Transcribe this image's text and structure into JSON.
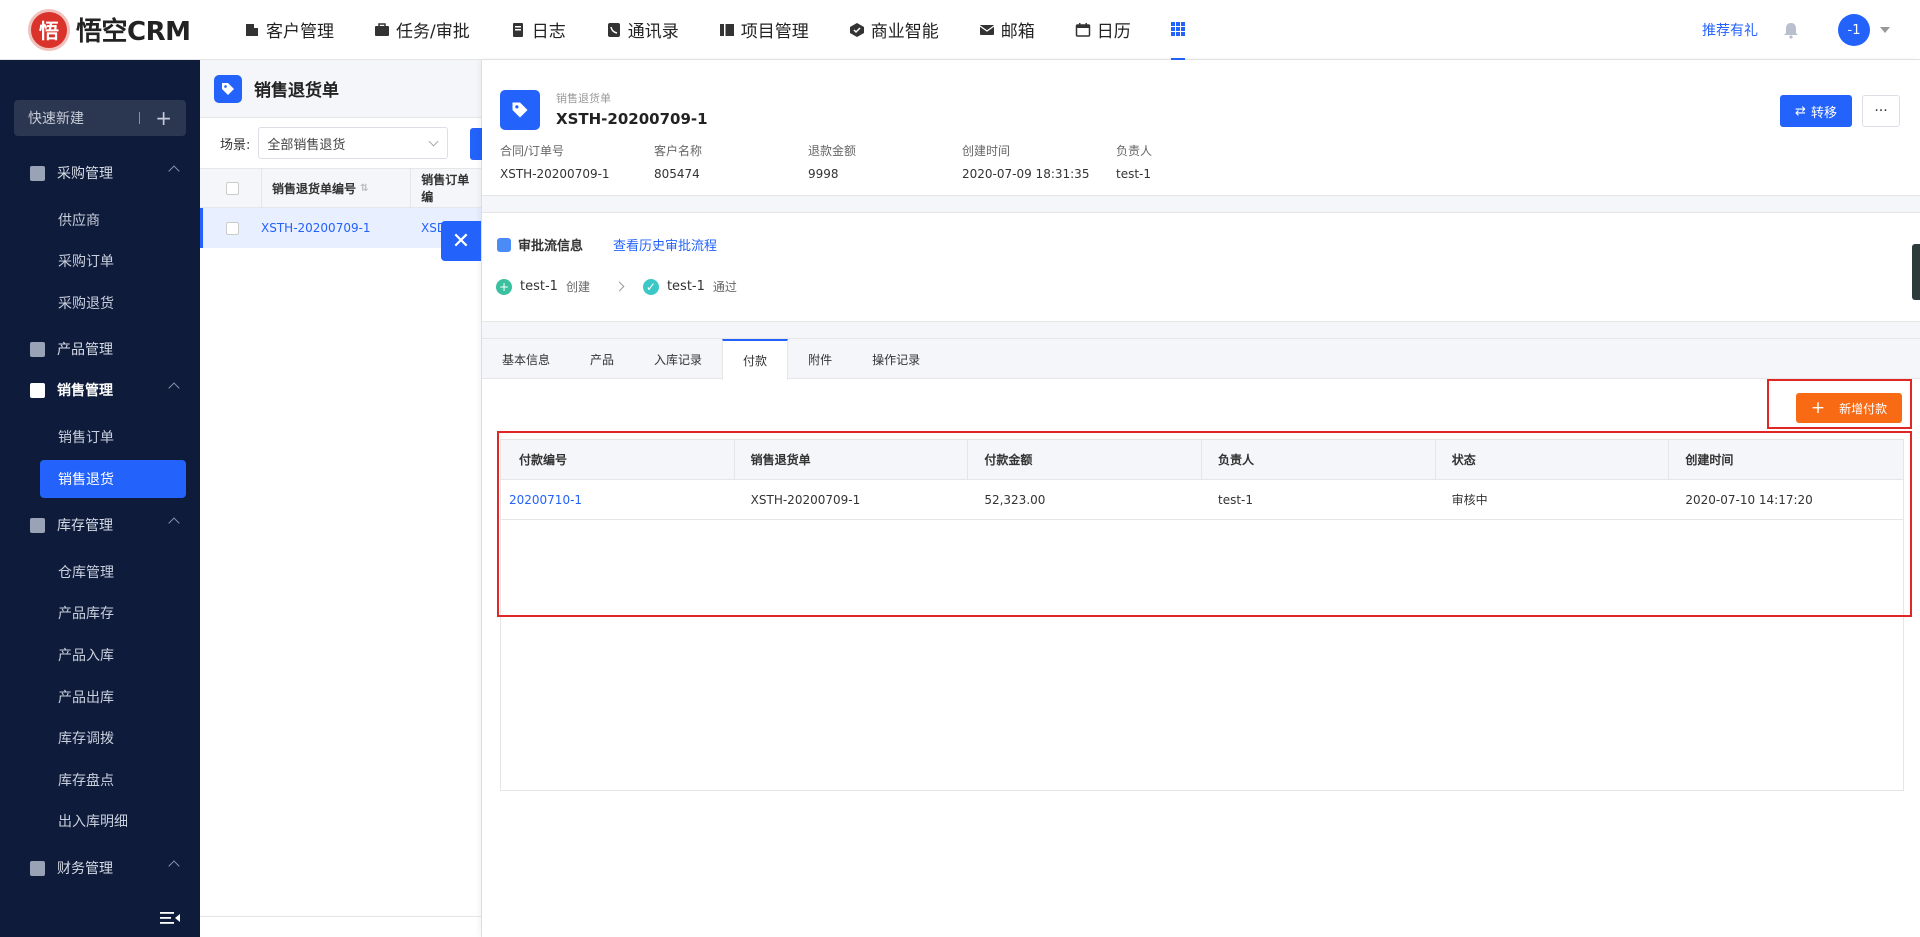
{
  "app": {
    "logo_mark": "悟",
    "logo_text": "悟空CRM"
  },
  "nav": {
    "items": [
      {
        "label": "客户管理",
        "icon": "building-icon"
      },
      {
        "label": "任务/审批",
        "icon": "briefcase-icon"
      },
      {
        "label": "日志",
        "icon": "log-icon"
      },
      {
        "label": "通讯录",
        "icon": "phone-icon"
      },
      {
        "label": "项目管理",
        "icon": "project-icon"
      },
      {
        "label": "商业智能",
        "icon": "bi-icon"
      },
      {
        "label": "邮箱",
        "icon": "mail-icon"
      },
      {
        "label": "日历",
        "icon": "calendar-icon"
      }
    ],
    "gift_label": "推荐有礼",
    "avatar_text": "-1"
  },
  "sidebar": {
    "quick_new": "快速新建",
    "groups": [
      {
        "label": "采购管理",
        "items": [
          "供应商",
          "采购订单",
          "采购退货"
        ]
      },
      {
        "label": "产品管理",
        "items": []
      },
      {
        "label": "销售管理",
        "items": [
          "销售订单",
          "销售退货"
        ]
      },
      {
        "label": "库存管理",
        "items": [
          "仓库管理",
          "产品库存",
          "产品入库",
          "产品出库",
          "库存调拨",
          "库存盘点",
          "出入库明细"
        ]
      },
      {
        "label": "财务管理",
        "items": []
      }
    ]
  },
  "list": {
    "title": "销售退货单",
    "scene_label": "场景:",
    "scene_value": "全部销售退货",
    "columns": [
      "销售退货单编号",
      "销售订单编"
    ],
    "rows": [
      {
        "no": "XSTH-20200709-1",
        "order": "XSD"
      }
    ]
  },
  "detail": {
    "subtitle": "销售退货单",
    "title": "XSTH-20200709-1",
    "transfer_label": "转移",
    "more_label": "···",
    "fields": [
      {
        "label": "合同/订单号",
        "value": "XSTH-20200709-1"
      },
      {
        "label": "客户名称",
        "value": "805474"
      },
      {
        "label": "退款金额",
        "value": "9998"
      },
      {
        "label": "创建时间",
        "value": "2020-07-09 18:31:35"
      },
      {
        "label": "负责人",
        "value": "test-1"
      }
    ],
    "approval": {
      "title": "审批流信息",
      "history_link": "查看历史审批流程",
      "steps": [
        {
          "user": "test-1",
          "action": "创建"
        },
        {
          "user": "test-1",
          "action": "通过"
        }
      ]
    },
    "tabs": [
      "基本信息",
      "产品",
      "入库记录",
      "付款",
      "附件",
      "操作记录"
    ],
    "active_tab": "付款",
    "add_payment_label": "新增付款",
    "payment_table": {
      "columns": [
        "付款编号",
        "销售退货单",
        "付款金额",
        "负责人",
        "状态",
        "创建时间"
      ],
      "rows": [
        [
          "20200710-1",
          "XSTH-20200709-1",
          "52,323.00",
          "test-1",
          "审核中",
          "2020-07-10 14:17:20"
        ]
      ]
    }
  },
  "colors": {
    "accent": "#2362fb",
    "sidebar_bg": "#0e1b3a",
    "add_button": "#f96a14",
    "highlight": "#e12626"
  }
}
